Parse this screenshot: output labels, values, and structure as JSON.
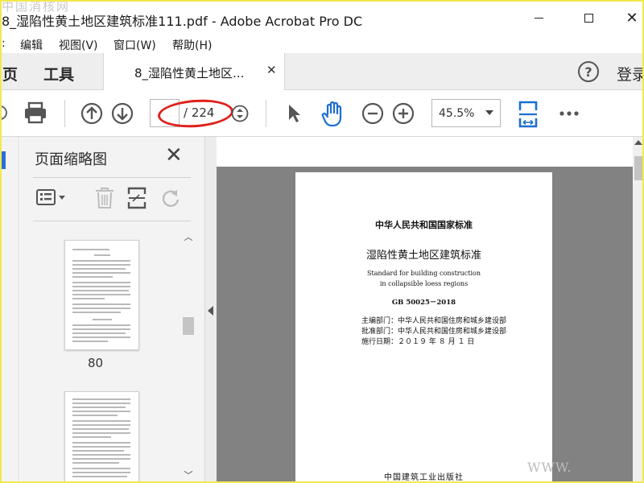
{
  "window": {
    "title": "8_湿陷性黄土地区建筑标准111.pdf - Adobe Acrobat Pro DC",
    "watermark_top": "中国消核网"
  },
  "menu": [
    "编辑",
    "视图(V)",
    "窗口(W)",
    "帮助(H)"
  ],
  "tabs": {
    "home": "页",
    "tools": "工具",
    "document": "8_湿陷性黄土地区...",
    "login": "登录"
  },
  "toolbar": {
    "page_current": "",
    "page_total": "/ 224",
    "zoom": "45.5%"
  },
  "panel": {
    "title": "页面缩略图",
    "thumb_page_number": "80"
  },
  "document": {
    "heading": "中华人民共和国国家标准",
    "title_cn": "湿陷性黄土地区建筑标准",
    "title_en_line1": "Standard for building construction",
    "title_en_line2": "in collapsible loess regions",
    "code": "GB 50025－2018",
    "chief_editor": "主编部门：中华人民共和国住房和城乡建设部",
    "approver": "批准部门：中华人民共和国住房和城乡建设部",
    "effective_date": "施行日期：２０１９ 年 ８ 月 １ 日",
    "publisher": "中国建筑工业出版社"
  },
  "watermark_bottom": "WWW.",
  "colors": {
    "accent_blue": "#1a6fd0",
    "annotation_red": "#e0201b",
    "frame_yellow": "#f2e94e"
  }
}
